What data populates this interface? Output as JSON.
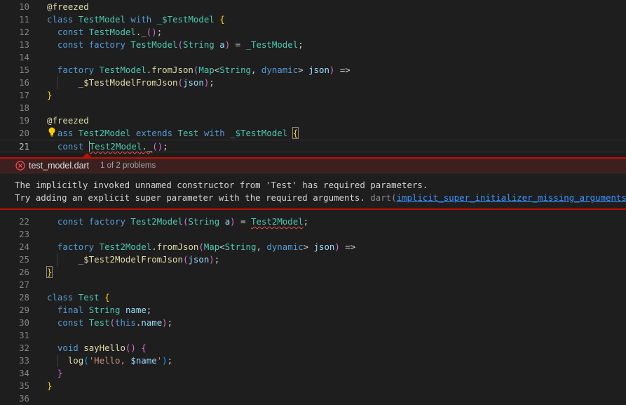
{
  "editor": {
    "lines_top": [
      {
        "num": "10",
        "html": "<span class=\"an\">@freezed</span>"
      },
      {
        "num": "11",
        "html": "<span class=\"kw\">class</span> <span class=\"ty\">TestModel</span> <span class=\"kw\">with</span> <span class=\"ty\">_$TestModel</span> <span class=\"br1\">{</span>"
      },
      {
        "num": "12",
        "html": "  <span class=\"kw\">const</span> <span class=\"ty\">TestModel</span>.<span class=\"fn\">_</span><span class=\"br2\">()</span>;"
      },
      {
        "num": "13",
        "html": "  <span class=\"kw\">const</span> <span class=\"kw\">factory</span> <span class=\"ty\">TestModel</span><span class=\"br2\">(</span><span class=\"ty\">String</span> <span class=\"vr\">a</span><span class=\"br2\">)</span> = <span class=\"ty\">_TestModel</span>;"
      },
      {
        "num": "14",
        "html": ""
      },
      {
        "num": "15",
        "html": "  <span class=\"kw\">factory</span> <span class=\"ty\">TestModel</span>.<span class=\"fn\">fromJson</span><span class=\"br2\">(</span><span class=\"ty\">Map</span>&lt;<span class=\"ty\">String</span>, <span class=\"kw\">dynamic</span>&gt; <span class=\"vr\">json</span><span class=\"br2\">)</span> =&gt;"
      },
      {
        "num": "16",
        "html": "      <span class=\"fn\">_$TestModelFromJson</span><span class=\"br2\">(</span><span class=\"vr\">json</span><span class=\"br2\">)</span>;"
      },
      {
        "num": "17",
        "html": "<span class=\"br1\">}</span>"
      },
      {
        "num": "18",
        "html": ""
      },
      {
        "num": "19",
        "html": "<span class=\"an\">@freezed</span>"
      },
      {
        "num": "20",
        "html": "  <span class=\"kw\">ass</span> <span class=\"ty\">Test2Model</span> <span class=\"kw\">extends</span> <span class=\"ty\">Test</span> <span class=\"kw\">with</span> <span class=\"ty\">_$TestModel</span> <span class=\"br1\" style=\"outline:1px solid #888\">{</span>"
      },
      {
        "num": "21",
        "html": "  <span class=\"kw\">const</span> <span class=\"cursor\"></span><span class=\"ty squig\">Test2Model</span><span class=\"squig\">.<span class=\"fn\">_</span></span><span class=\"br2\">()</span>;"
      }
    ],
    "lines_bottom": [
      {
        "num": "22",
        "html": "  <span class=\"kw\">const</span> <span class=\"kw\">factory</span> <span class=\"ty\">Test2Model</span><span class=\"br2\">(</span><span class=\"ty\">String</span> <span class=\"vr\">a</span><span class=\"br2\">)</span> = <span class=\"ty squig\">Test2Model</span>;"
      },
      {
        "num": "23",
        "html": ""
      },
      {
        "num": "24",
        "html": "  <span class=\"kw\">factory</span> <span class=\"ty\">Test2Model</span>.<span class=\"fn\">fromJson</span><span class=\"br2\">(</span><span class=\"ty\">Map</span>&lt;<span class=\"ty\">String</span>, <span class=\"kw\">dynamic</span>&gt; <span class=\"vr\">json</span><span class=\"br2\">)</span> =&gt;"
      },
      {
        "num": "25",
        "html": "      <span class=\"fn\">_$Test2ModelFromJson</span><span class=\"br2\">(</span><span class=\"vr\">json</span><span class=\"br2\">)</span>;"
      },
      {
        "num": "26",
        "html": "<span class=\"br1\" style=\"outline:1px solid #888\">}</span>"
      },
      {
        "num": "27",
        "html": ""
      },
      {
        "num": "28",
        "html": "<span class=\"kw\">class</span> <span class=\"ty\">Test</span> <span class=\"br1\">{</span>"
      },
      {
        "num": "29",
        "html": "  <span class=\"kw\">final</span> <span class=\"ty\">String</span> <span class=\"vr\">name</span>;"
      },
      {
        "num": "30",
        "html": "  <span class=\"kw\">const</span> <span class=\"ty\">Test</span><span class=\"br2\">(</span><span class=\"kw\">this</span>.<span class=\"vr\">name</span><span class=\"br2\">)</span>;"
      },
      {
        "num": "31",
        "html": ""
      },
      {
        "num": "32",
        "html": "  <span class=\"kw\">void</span> <span class=\"fn\">sayHello</span><span class=\"br2\">()</span> <span class=\"br2\">{</span>"
      },
      {
        "num": "33",
        "html": "    <span class=\"fn\">log</span><span class=\"br3\">(</span><span class=\"str\">'Hello, </span><span class=\"vr\">$name</span><span class=\"str\">'</span><span class=\"br3\">)</span>;"
      },
      {
        "num": "34",
        "html": "  <span class=\"br2\">}</span>"
      },
      {
        "num": "35",
        "html": "<span class=\"br1\">}</span>"
      },
      {
        "num": "36",
        "html": ""
      }
    ]
  },
  "peek": {
    "file": "test_model.dart",
    "count": "1 of 2 problems",
    "message_line1": "The implicitly invoked unnamed constructor from 'Test' has required parameters.",
    "message_line2": "Try adding an explicit super parameter with the required arguments.",
    "source": "dart(",
    "code": "implicit_super_initializer_missing_arguments",
    "source_close": ")"
  },
  "colors": {
    "error": "#f14c4c",
    "peek_border": "#be1100",
    "background": "#1e1e1e"
  },
  "icons": {
    "peek_status": "error-circle-icon",
    "code_action": "lightbulb-icon"
  }
}
